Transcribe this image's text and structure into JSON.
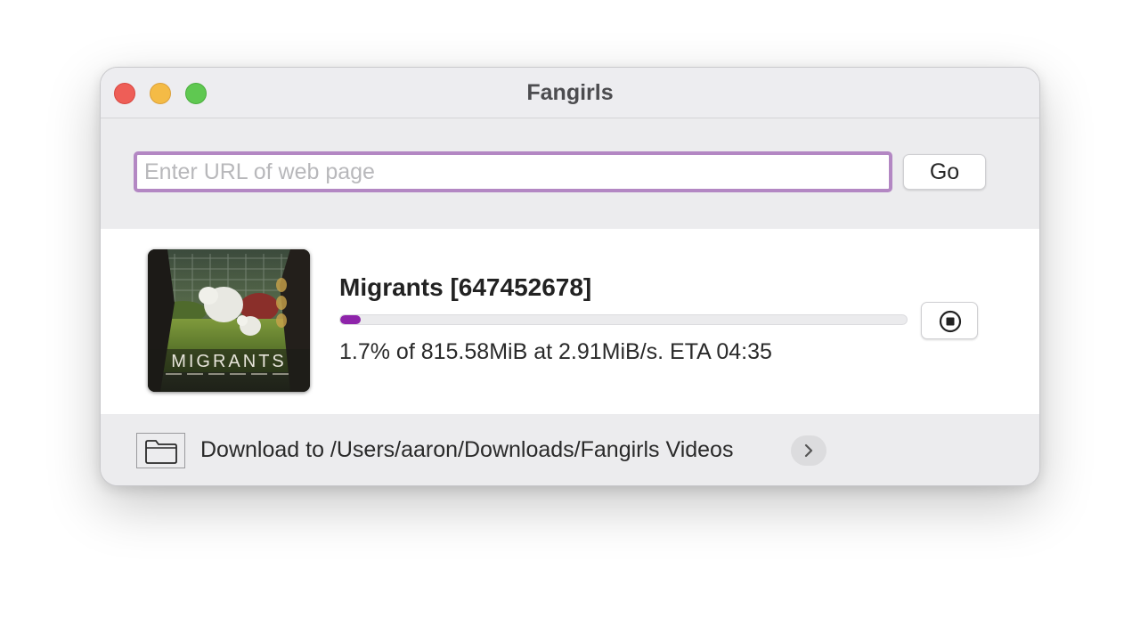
{
  "window": {
    "title": "Fangirls"
  },
  "url_bar": {
    "value": "",
    "placeholder": "Enter URL of web page",
    "go_label": "Go"
  },
  "download": {
    "title": "Migrants [647452678]",
    "progress_fraction": 0.017,
    "status": "1.7% of 815.58MiB at 2.91MiB/s. ETA 04:35",
    "thumbnail_text": "MIGRANTS",
    "stop_icon": "stop-circle-icon"
  },
  "footer": {
    "folder_icon": "folder-icon",
    "path_label": "Download to /Users/aaron/Downloads/Fangirls Videos",
    "chevron_icon": "chevron-right-icon"
  },
  "colors": {
    "accent_purple": "#8e24aa",
    "focus_ring": "#b387c3",
    "close": "#ee5e57",
    "minimize": "#f4bb46",
    "maximize": "#5fc851"
  }
}
